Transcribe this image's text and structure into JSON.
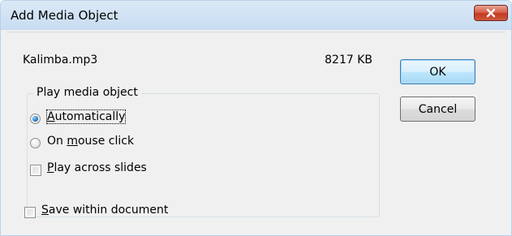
{
  "window": {
    "title": "Add Media Object"
  },
  "file": {
    "name": "Kalimba.mp3",
    "size": "8217 KB"
  },
  "buttons": {
    "ok": "OK",
    "cancel": "Cancel"
  },
  "play_group": {
    "legend": "Play media object",
    "options": [
      {
        "accel": "A",
        "rest": "utomatically",
        "selected": true
      },
      {
        "pre": "On ",
        "accel": "m",
        "rest": "ouse click",
        "selected": false
      }
    ],
    "play_across": {
      "accel": "P",
      "rest": "lay across slides",
      "checked": false
    }
  },
  "save_within": {
    "accel": "S",
    "rest": "ave within document",
    "checked": false
  },
  "icons": {
    "close": "close-icon"
  },
  "colors": {
    "title_bar": "#c8dcf1",
    "close_button": "#c4391f",
    "radio_selected": "#2a7fc9",
    "dialog_bg": "#f0f0f0"
  }
}
